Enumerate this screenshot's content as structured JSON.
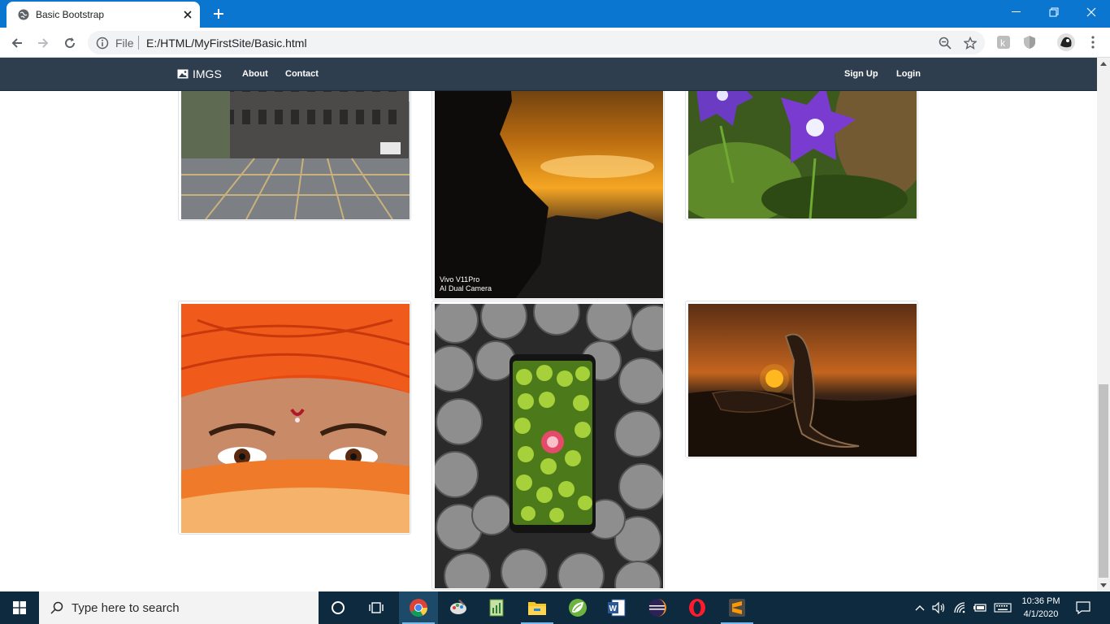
{
  "browser": {
    "tab_title": "Basic Bootstrap",
    "file_label": "File",
    "url": "E:/HTML/MyFirstSite/Basic.html"
  },
  "page": {
    "brand": "IMGS",
    "nav_left": [
      "About",
      "Contact"
    ],
    "nav_right": [
      "Sign Up",
      "Login"
    ],
    "photo_caption_line1": "Vivo V11Pro",
    "photo_caption_line2": "AI Dual Camera"
  },
  "taskbar": {
    "search_placeholder": "Type here to search",
    "time": "10:36 PM",
    "date": "4/1/2020"
  },
  "colors": {
    "chrome_blue": "#0a76d0",
    "navbar": "#2f3e4e",
    "taskbar": "#0d2a3e"
  }
}
